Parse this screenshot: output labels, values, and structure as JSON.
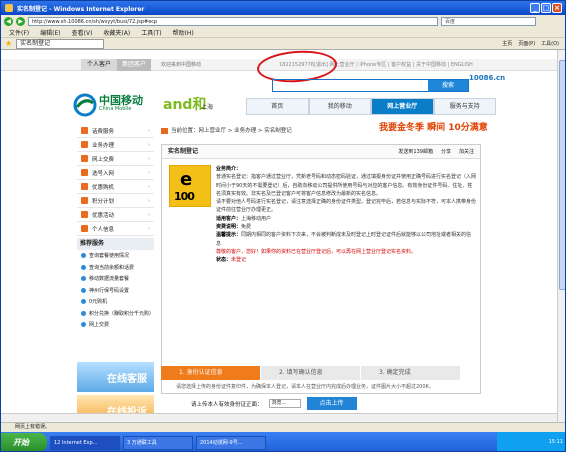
{
  "window": {
    "title": "实名制登记 - Windows Internet Explorer"
  },
  "address": {
    "url": "http://www.sh.10086.cn/sh/wsyyt/busi/72.jsp#ecp",
    "search_placeholder": "百度"
  },
  "menubar": [
    "文件(F)",
    "编辑(E)",
    "查看(V)",
    "收藏夹(A)",
    "工具(T)",
    "帮助(H)"
  ],
  "tab": {
    "label": "实名制登记",
    "tools": [
      "主页",
      "页面(P)",
      "工具(O)"
    ]
  },
  "topnav": {
    "personal": "个人客户",
    "enterprise": "集团客户",
    "welcome": "欢迎来到中国移动",
    "phone": "18221529776[退出]",
    "links": "网上营业厅 | iPhone专区 | 客户权益 | 关于中国移动 | ENGLISH"
  },
  "logo": {
    "name": "中国移动",
    "sub": "China Mobile",
    "and": "and和",
    "city": "上海",
    "brand": "10086.cn"
  },
  "search": {
    "button": "搜索"
  },
  "mainnav": [
    "首页",
    "我的移动",
    "网上营业厅",
    "服务与支持"
  ],
  "sidebar": {
    "items": [
      "话费服务",
      "业务办理",
      "网上交费",
      "选号入网",
      "优惠购机",
      "积分计划",
      "优惠活动",
      "个人信息"
    ],
    "recom_title": "推荐服务",
    "recom": [
      "查询套餐使用情况",
      "查询当前余额和话费",
      "移动数据流量套餐",
      "神州行保号码设置",
      "0元购机",
      "积分兑换（赚取积分千元购）",
      "网上交费"
    ],
    "banner1": "在线客服",
    "banner2": "在线投诉"
  },
  "breadcrumb": "当前位置：网上营业厅 > 业务办理 > 实名制登记",
  "promo": "我要金冬季 瞬间 10分满意",
  "panel": {
    "title": "实名制登记",
    "tools": [
      "发送到139邮箱",
      "分享",
      "加关注"
    ],
    "logo_top": "e",
    "logo_bottom": "100",
    "intro_label": "业务简介：",
    "intro": "普通实名登记：指客户通过营业厅，凭新老号码和动态密码验证，通过填报身份证并使用正确号码进行实名登记（入网时间小于90天的不需要登记）后，自助向移动公司提供所使用号码与对应的客户信息。有效身份证件号码、住址、姓名须真实有效。非实名及已登记客户可将客户信息修改为最新的实名信息。",
    "intro2": "请不要对他人号码进行实名登记，请注意选择正确的身份证件类型。登记完毕后，若信息与实际不符，可本人携带身份证件前往营业厅办理更正。",
    "target_label": "适用客户：",
    "target": "上海移动用户",
    "fee_label": "资费说明：",
    "fee": "免费",
    "warn_label": "温馨提示：",
    "warn": "同期内相同的客户资料下次来，不会被判断成未及时登记上时登记证件后就能够以公司地址或者相关的信息",
    "red_note": "尊敬的客户，您好！如果你的资料已在营业厅登记后，可以再在网上营业厅登记实名资料。",
    "status_label": "状态：",
    "status": "未登记"
  },
  "steps": [
    "1. 身份认证信息",
    "2. 填写确认信息",
    "3. 确定完成"
  ],
  "note": "请您选择上传的身份证件复印件，为确保本人登记，请本人在营业厅内完成后办理业务，证件图片大小不超过200K。",
  "upload": {
    "label": "请上传本人有效身份证正面：",
    "input": "浏览...",
    "button": "点击上传"
  },
  "statusbar": "网页上有错误。",
  "taskbar": {
    "start": "开始",
    "tasks": [
      "12 Internet Exp...",
      "3 万通联工具",
      "2014动漫网-9号..."
    ],
    "tray": "15:11"
  }
}
